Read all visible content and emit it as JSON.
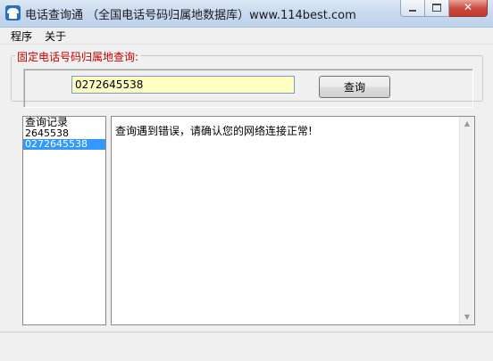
{
  "window": {
    "title": "电话查询通 （全国电话号码归属地数据库）www.114best.com",
    "icon": "phone-app-icon",
    "controls": {
      "minimize": "minimize-icon",
      "maximize": "maximize-icon",
      "close": "✕"
    }
  },
  "menu": {
    "items": [
      {
        "label": "程序"
      },
      {
        "label": "关于"
      }
    ]
  },
  "query": {
    "group_label": "固定电话号码归属地查询:",
    "input_value": "0272645538",
    "button_label": "查询"
  },
  "history": {
    "header": "查询记录",
    "items": [
      {
        "label": "2645538",
        "selected": false
      },
      {
        "label": "0272645538",
        "selected": true
      }
    ]
  },
  "result": {
    "text": "查询遇到错误，请确认您的网络连接正常!"
  },
  "colors": {
    "legend": "#c00000",
    "input_bg": "#ffffc4",
    "selection": "#3399ff"
  }
}
